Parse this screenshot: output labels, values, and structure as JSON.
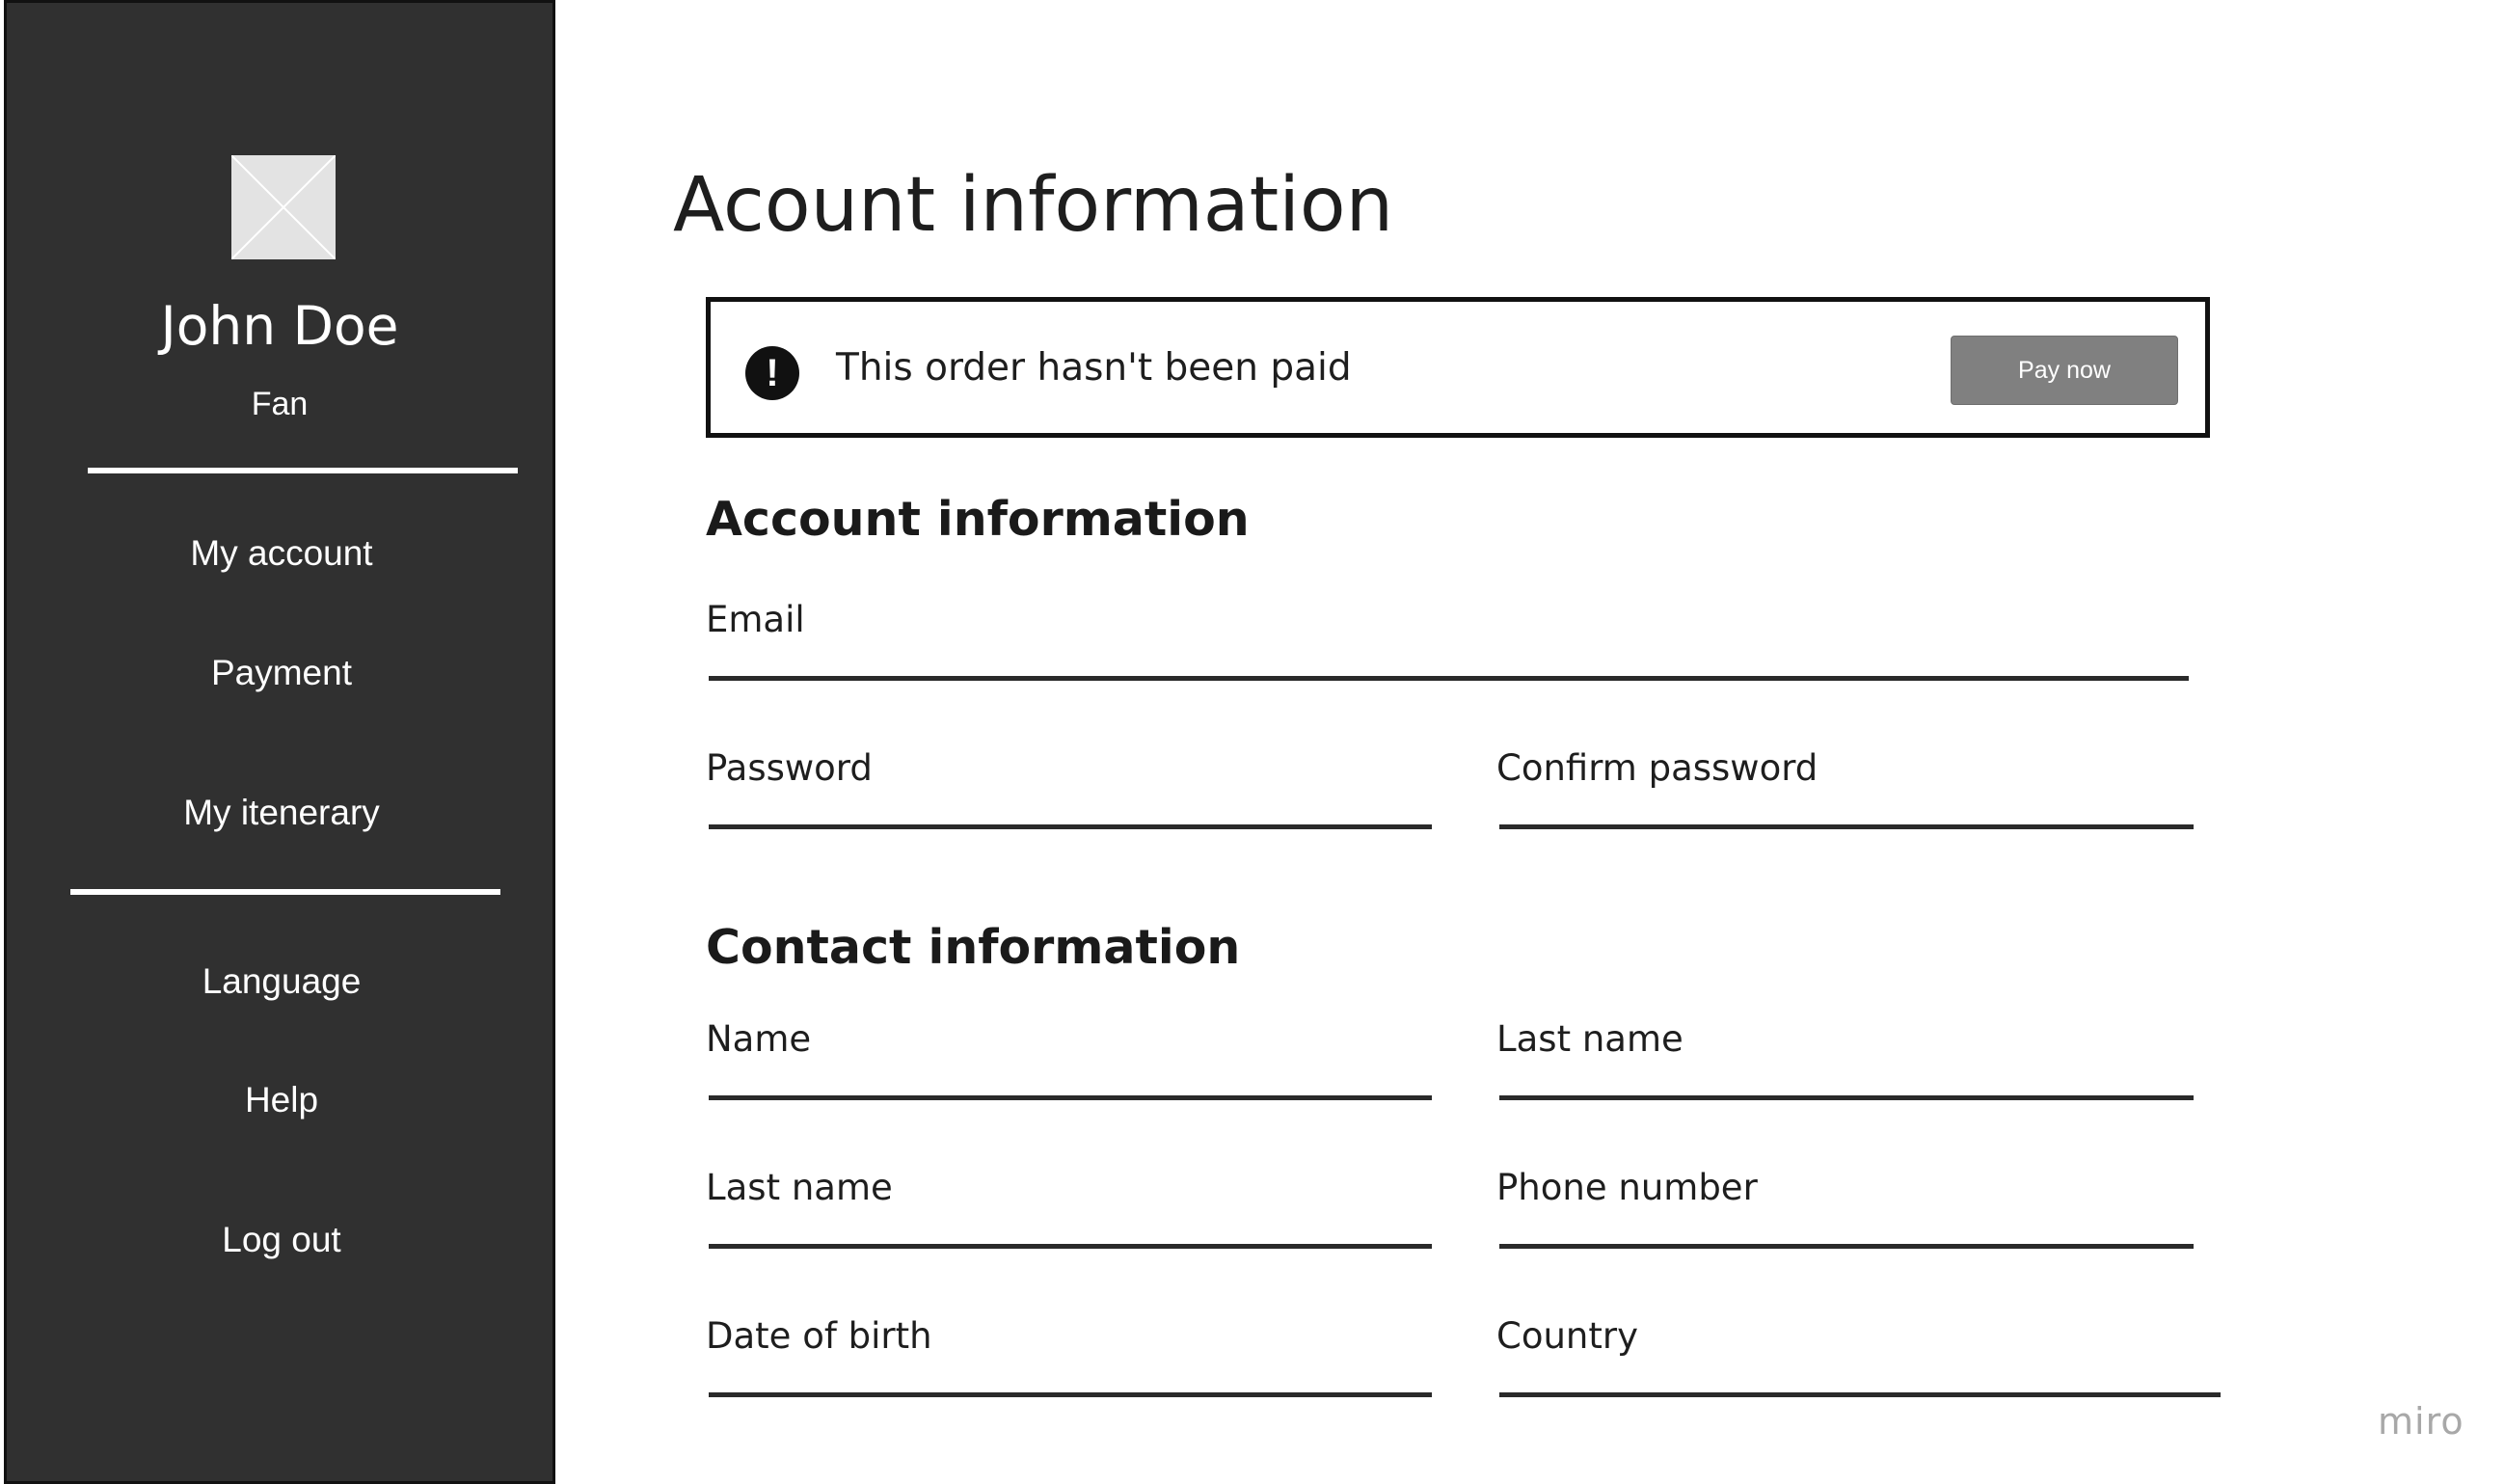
{
  "sidebar": {
    "user_name": "John Doe",
    "user_role": "Fan",
    "nav_primary": [
      {
        "label": "My account"
      },
      {
        "label": "Payment"
      },
      {
        "label": "My itenerary"
      }
    ],
    "nav_secondary": [
      {
        "label": "Language"
      },
      {
        "label": "Help"
      },
      {
        "label": "Log out"
      }
    ]
  },
  "main": {
    "page_title": "Acount information",
    "alert": {
      "icon": "exclamation-circle-icon",
      "message": "This order hasn't been paid",
      "button_label": "Pay now"
    },
    "account_section": {
      "title": "Account information",
      "fields": {
        "email": "Email",
        "password": "Password",
        "confirm_password": "Confirm password"
      }
    },
    "contact_section": {
      "title": "Contact information",
      "fields": {
        "name": "Name",
        "last_name": "Last name",
        "last_name_2": "Last name",
        "phone_number": "Phone number",
        "date_of_birth": "Date of birth",
        "country": "Country"
      }
    }
  },
  "watermark": "miro",
  "colors": {
    "sidebar_bg": "#303030",
    "button_bg": "#808080",
    "avatar_bg": "#e3e3e3"
  }
}
